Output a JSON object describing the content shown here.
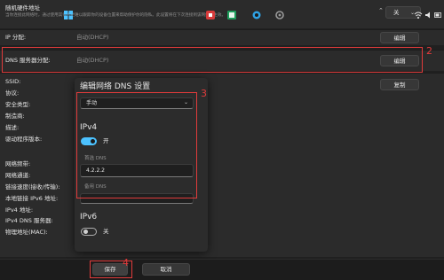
{
  "random_mac": {
    "title": "随机硬件地址",
    "description": "当你连接此网络时，通过使用其他人更难以跟踪你的设备位置来帮助保护你的隐私。此设置将在下次连接到该网络时生效。",
    "select_value": "关"
  },
  "ip_assignment": {
    "label": "IP 分配:",
    "value": "自动(DHCP)",
    "edit_label": "编辑"
  },
  "dns_assignment": {
    "label": "DNS 服务器分配:",
    "value": "自动(DHCP)",
    "edit_label": "编辑"
  },
  "properties": {
    "copy_label": "复制",
    "labels": [
      "SSID:",
      "协议:",
      "安全类型:",
      "制造商:",
      "描述:",
      "驱动程序版本:",
      "网络频带:",
      "网络通道:",
      "链接速度(接收/传输):",
      "本地链接 IPv6 地址:",
      "IPv4 地址:",
      "IPv4 DNS 服务器:",
      "物理地址(MAC):"
    ]
  },
  "dialog": {
    "title": "编辑网络 DNS 设置",
    "mode_value": "手动",
    "ipv4": {
      "heading": "IPv4",
      "toggle_label": "开",
      "toggle_on": true,
      "preferred_label": "首选 DNS",
      "preferred_value": "4.2.2.2",
      "alternate_label": "备用 DNS"
    },
    "ipv6": {
      "heading": "IPv6",
      "toggle_label": "关",
      "toggle_on": false
    },
    "save_label": "保存",
    "cancel_label": "取消"
  },
  "annotations": [
    "2",
    "3",
    "4"
  ],
  "colors": {
    "accent": "#4cc2ff",
    "annotation": "#e03b3b",
    "background": "#202020",
    "card": "#2b2b2b"
  },
  "taskbar": {
    "icons": [
      "windows-start-icon",
      "search-icon",
      "file-explorer-icon",
      "edge-browser-icon",
      "settings-icon"
    ],
    "tray_icons": [
      "chevron-up-icon",
      "wifi-icon",
      "speaker-icon",
      "battery-icon"
    ]
  }
}
